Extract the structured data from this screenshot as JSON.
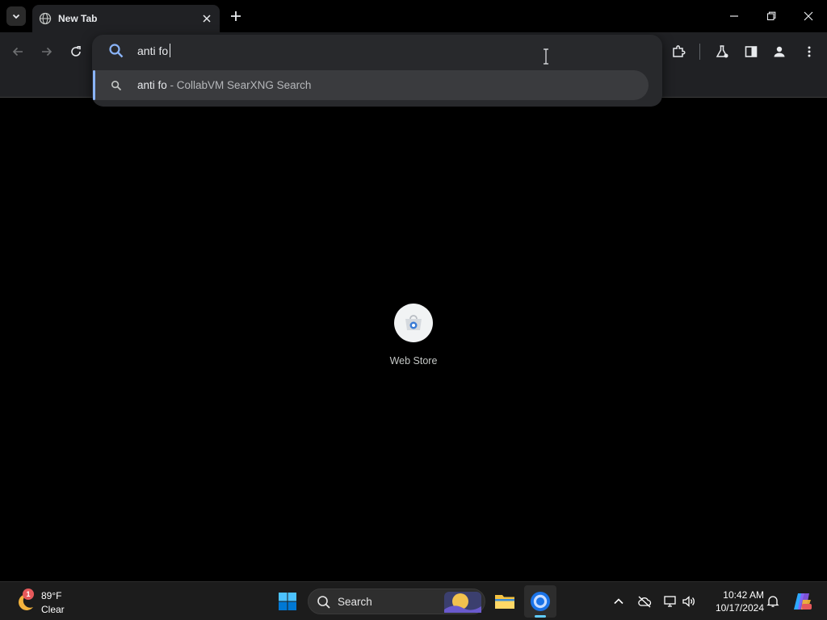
{
  "browser": {
    "tab": {
      "title": "New Tab"
    },
    "omnibox": {
      "value": "anti fo",
      "suggestion": {
        "query": "anti fo",
        "separator": " - ",
        "engine": "CollabVM SearXNG Search"
      }
    }
  },
  "page": {
    "shortcuts": [
      {
        "label": "Web Store",
        "icon": "web-store-icon"
      }
    ]
  },
  "taskbar": {
    "weather": {
      "temp": "89°F",
      "condition": "Clear",
      "badge": "1"
    },
    "search": {
      "label": "Search"
    },
    "clock": {
      "time": "10:42 AM",
      "date": "10/17/2024"
    }
  },
  "colors": {
    "accent": "#8ab4f8",
    "toolbar": "#202124",
    "popup": "#28292c",
    "taskbar": "#1c1c1c",
    "taskbar_active_indicator": "#60cdff"
  }
}
